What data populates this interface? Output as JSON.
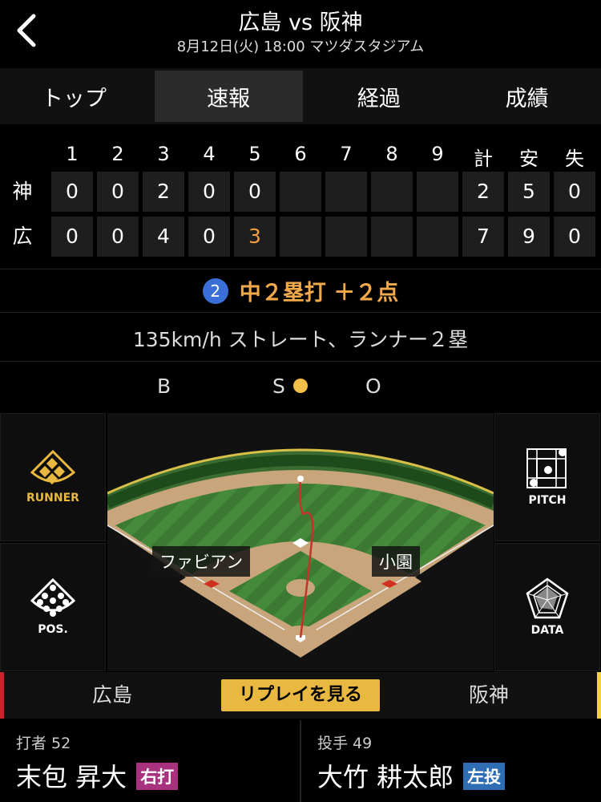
{
  "header": {
    "title": "広島 vs 阪神",
    "subtitle": "8月12日(火) 18:00 マツダスタジアム"
  },
  "tabs": [
    {
      "label": "トップ"
    },
    {
      "label": "速報"
    },
    {
      "label": "経過"
    },
    {
      "label": "成績"
    }
  ],
  "scoreboard": {
    "headers": [
      "1",
      "2",
      "3",
      "4",
      "5",
      "6",
      "7",
      "8",
      "9",
      "計",
      "安",
      "失"
    ],
    "rows": [
      {
        "team": "神",
        "cells": [
          "0",
          "0",
          "2",
          "0",
          "0",
          "",
          "",
          "",
          "",
          "2",
          "5",
          "0"
        ]
      },
      {
        "team": "広",
        "cells": [
          "0",
          "0",
          "4",
          "0",
          "3",
          "",
          "",
          "",
          "",
          "7",
          "9",
          "0"
        ]
      }
    ]
  },
  "play": {
    "badge": "2",
    "text": "中２塁打 ＋２点",
    "pitch": "135km/h ストレート、ランナー２塁"
  },
  "count": {
    "b": "B",
    "s": "S",
    "o": "O",
    "strikes": 1
  },
  "panels": {
    "runner": "RUNNER",
    "pos": "POS.",
    "pitch": "PITCH",
    "data": "DATA"
  },
  "field": {
    "left_fielder": "ファビアン",
    "right_fielder": "小園"
  },
  "bottom": {
    "home": "広島",
    "replay": "リプレイを見る",
    "away": "阪神"
  },
  "batter": {
    "label": "打者 52",
    "name": "末包 昇大",
    "tag": "右打"
  },
  "pitcher": {
    "label": "投手 49",
    "name": "大竹 耕太郎",
    "tag": "左投"
  },
  "colors": {
    "accent": "#f2a94a",
    "batter_tag": "#a8327e",
    "pitcher_tag": "#2f6db5",
    "replay": "#e8b840"
  }
}
